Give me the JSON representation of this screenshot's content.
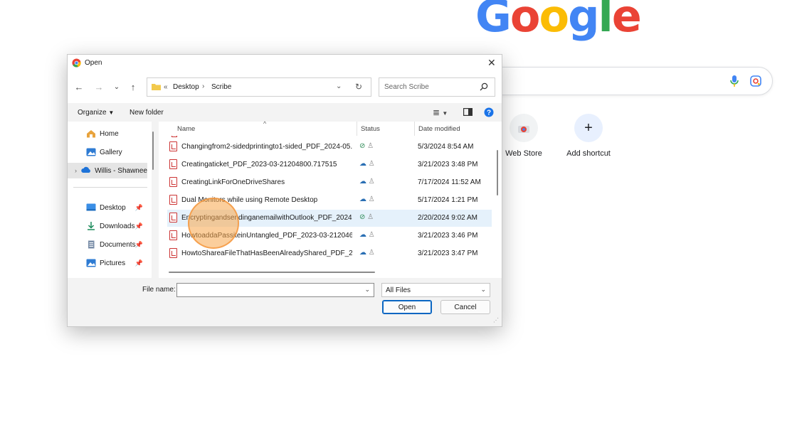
{
  "google": {
    "logo_letters": [
      {
        "ch": "G",
        "color": "#4285F4"
      },
      {
        "ch": "o",
        "color": "#EA4335"
      },
      {
        "ch": "o",
        "color": "#FBBC05"
      },
      {
        "ch": "g",
        "color": "#4285F4"
      },
      {
        "ch": "l",
        "color": "#34A853"
      },
      {
        "ch": "e",
        "color": "#EA4335"
      }
    ],
    "shortcuts": [
      {
        "label": "Web Store",
        "icon": "chrome-web-store-icon"
      },
      {
        "label": "Add shortcut",
        "icon": "plus-icon"
      }
    ]
  },
  "dialog": {
    "title": "Open",
    "breadcrumb": {
      "overflow": "«",
      "items": [
        "Desktop",
        "Scribe"
      ]
    },
    "search_placeholder": "Search Scribe",
    "toolbar": {
      "organize": "Organize",
      "new_folder": "New folder"
    },
    "nav": {
      "items": [
        {
          "label": "Home",
          "icon": "home-icon"
        },
        {
          "label": "Gallery",
          "icon": "gallery-icon"
        },
        {
          "label": "Willis - Shawnee",
          "icon": "onedrive-cloud-icon"
        },
        {
          "label": "Desktop",
          "icon": "desktop-folder-icon",
          "pinned": true
        },
        {
          "label": "Downloads",
          "icon": "download-icon",
          "pinned": true
        },
        {
          "label": "Documents",
          "icon": "documents-icon",
          "pinned": true
        },
        {
          "label": "Pictures",
          "icon": "pictures-icon",
          "pinned": true
        }
      ]
    },
    "columns": {
      "name": "Name",
      "status": "Status",
      "date": "Date modified"
    },
    "files": [
      {
        "name": "Changingfrom2-sidedprintingto1-sided_PDF_2024-05...",
        "status": "synced",
        "date": "5/3/2024 8:54 AM"
      },
      {
        "name": "Creatingaticket_PDF_2023-03-21204800.717515",
        "status": "cloud",
        "date": "3/21/2023 3:48 PM"
      },
      {
        "name": "CreatingLinkForOneDriveShares",
        "status": "cloud",
        "date": "7/17/2024 11:52 AM"
      },
      {
        "name": "Dual Monitors while using Remote Desktop",
        "status": "cloud",
        "date": "5/17/2024 1:21 PM"
      },
      {
        "name": "EncryptingandsendinganemailwithOutlook_PDF_2024...",
        "status": "synced",
        "date": "2/20/2024 9:02 AM",
        "selected": true
      },
      {
        "name": "HowtoaddaPassiteinUntangled_PDF_2023-03-212046...",
        "status": "cloud",
        "date": "3/21/2023 3:46 PM"
      },
      {
        "name": "HowtoShareaFileThatHasBeenAlreadyShared_PDF_202...",
        "status": "cloud",
        "date": "3/21/2023 3:47 PM"
      }
    ],
    "file_name_label": "File name:",
    "file_name_value": "",
    "file_type": "All Files",
    "open_label": "Open",
    "cancel_label": "Cancel",
    "colors": {
      "accent": "#0a66c2",
      "selection": "#e5f1fb",
      "synced": "#2e8b57",
      "cloud": "#2a6fb4"
    }
  }
}
